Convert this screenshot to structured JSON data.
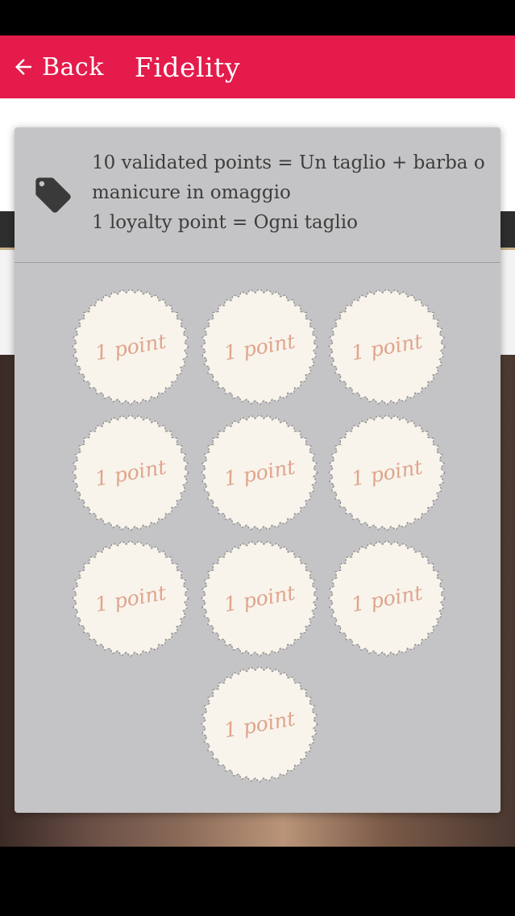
{
  "appbar": {
    "back_label": "Back",
    "title": "Fidelity",
    "color": "#e41b4b"
  },
  "rules": {
    "icon": "tag-icon",
    "line1": "10 validated points = Un taglio + barba o manicure in omaggio",
    "line2": "1 loyalty point = Ogni taglio"
  },
  "stamps": {
    "label": "1 point",
    "count": 10,
    "items": [
      "1 point",
      "1 point",
      "1 point",
      "1 point",
      "1 point",
      "1 point",
      "1 point",
      "1 point",
      "1 point",
      "1 point"
    ]
  }
}
